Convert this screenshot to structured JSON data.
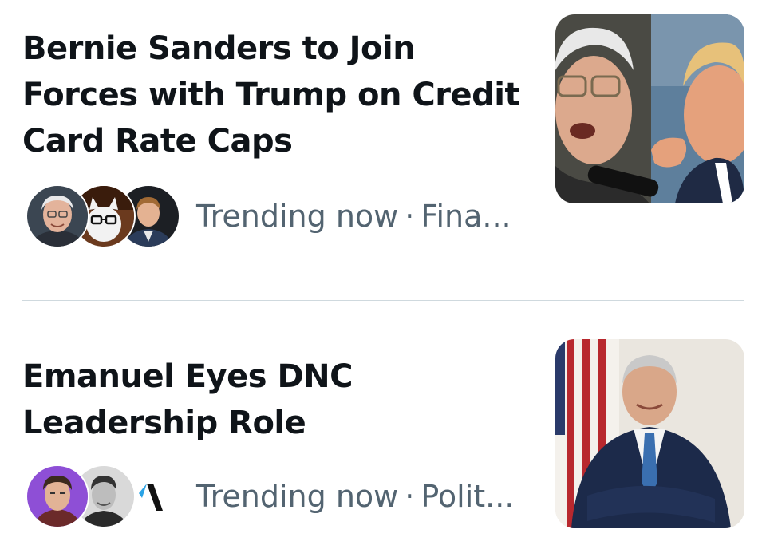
{
  "stories": [
    {
      "headline_lines": [
        "Bernie Sanders to Join",
        "Forces with Trump on Credit",
        "Card Rate Caps"
      ],
      "status": "Trending now",
      "separator": "·",
      "category": "Fina...",
      "avatars": [
        "avatar-older-man-glasses",
        "avatar-cat-glasses",
        "avatar-young-man-suit"
      ],
      "thumbnail": "sanders-and-trump-photo"
    },
    {
      "headline_lines": [
        "Emanuel Eyes DNC",
        "Leadership Role"
      ],
      "status": "Trending now",
      "separator": "·",
      "category": "Polit...",
      "avatars": [
        "avatar-man-purple-background",
        "avatar-man-grayscale",
        "avatar-axios-logo"
      ],
      "thumbnail": "man-in-suit-with-flag-photo"
    }
  ]
}
